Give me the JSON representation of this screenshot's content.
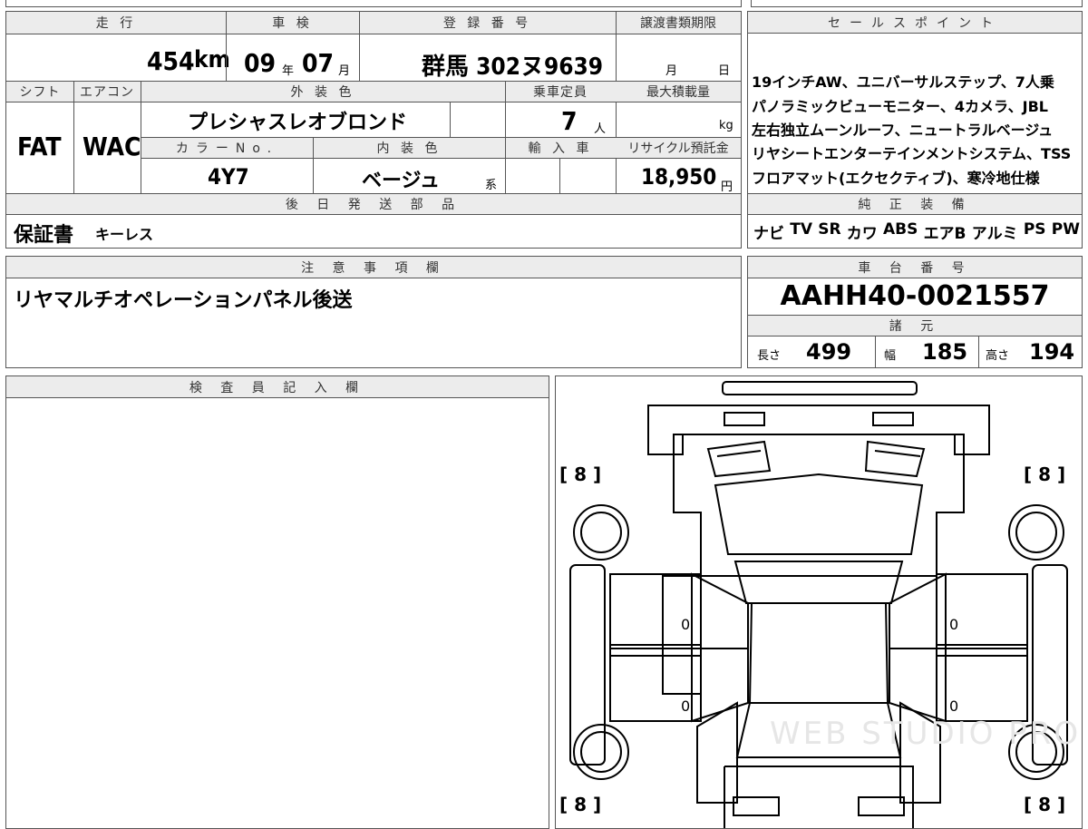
{
  "top_table": {
    "mileage_header": "走 行",
    "mileage_value": "454",
    "mileage_unit": "km",
    "inspection_header": "車 検",
    "inspection_year": "09",
    "inspection_year_unit": "年",
    "inspection_month": "07",
    "inspection_month_unit": "月",
    "registration_header": "登 録 番 号",
    "registration_value": "群馬 302ヌ9639",
    "transfer_deadline_header": "譲渡書類期限",
    "transfer_month_unit": "月",
    "transfer_day_unit": "日",
    "shift_header": "シフト",
    "shift_value": "FAT",
    "aircon_header": "エアコン",
    "aircon_value": "WAC",
    "exterior_color_header": "外 装 色",
    "exterior_color_value": "プレシャスレオブロンド",
    "capacity_header": "乗車定員",
    "capacity_value": "7",
    "capacity_unit": "人",
    "max_load_header": "最大積載量",
    "max_load_unit": "kg",
    "color_no_header": "カラーNo.",
    "color_no_value": "4Y7",
    "interior_color_header": "内 装 色",
    "interior_color_value": "ベージュ",
    "interior_color_suffix": "系",
    "import_header": "輸 入 車",
    "recycle_header": "リサイクル預託金",
    "recycle_value": "18,950",
    "recycle_unit": "円",
    "later_parts_header": "後 日 発 送 部 品",
    "later_parts_value": "保証書",
    "later_parts_value2": "キーレス"
  },
  "sales_points": {
    "header": "セールスポイント",
    "lines": [
      "19インチAW、ユニバーサルステップ、7人乗",
      "パノラミックビューモニター、4カメラ、JBL",
      "左右独立ムーンルーフ、ニュートラルベージュ",
      "リヤシートエンターテインメントシステム、TSS",
      "フロアマット(エクセクティブ)、寒冷地仕様"
    ]
  },
  "equipment": {
    "header": "純 正 装 備",
    "items": [
      "ナビ",
      "TV",
      "SR",
      "カワ",
      "ABS",
      "エアB",
      "アルミ",
      "PS",
      "PW"
    ]
  },
  "notes": {
    "header": "注 意 事 項 欄",
    "value": "リヤマルチオペレーションパネル後送"
  },
  "chassis": {
    "header": "車 台 番 号",
    "value": "AAHH40-0021557"
  },
  "specs": {
    "header": "諸 元",
    "length_label": "長さ",
    "length_value": "499",
    "width_label": "幅",
    "width_value": "185",
    "height_label": "高さ",
    "height_value": "194"
  },
  "inspector": {
    "header": "検 査 員 記 入 欄"
  },
  "diagram": {
    "tire_fl": "[ 8 ]",
    "tire_fr": "[ 8 ]",
    "tire_rl": "[ 8 ]",
    "tire_rr": "[ 8 ]",
    "door_fl": "0",
    "door_fr": "0",
    "door_rl": "0",
    "door_rr": "0",
    "watermark": "WEB STUDIO PRO"
  }
}
